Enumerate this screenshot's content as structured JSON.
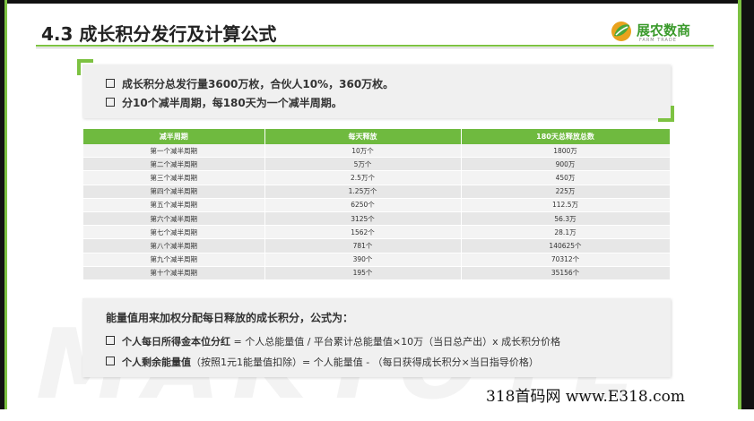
{
  "header": {
    "title": "4.3 成长积分发行及计算公式",
    "logo_text": "展农数商",
    "logo_sub": "FARM TRADE"
  },
  "intro": {
    "lines": [
      "成长积分总发行量3600万枚，合伙人10%，360万枚。",
      "分10个减半周期，每180天为一个减半周期。"
    ]
  },
  "table": {
    "headers": [
      "减半周期",
      "每天释放",
      "180天总释放总数"
    ],
    "rows": [
      [
        "第一个减半周期",
        "10万个",
        "1800万"
      ],
      [
        "第二个减半周期",
        "5万个",
        "900万"
      ],
      [
        "第三个减半周期",
        "2.5万个",
        "450万"
      ],
      [
        "第四个减半周期",
        "1.25万个",
        "225万"
      ],
      [
        "第五个减半周期",
        "6250个",
        "112.5万"
      ],
      [
        "第六个减半周期",
        "3125个",
        "56.3万"
      ],
      [
        "第七个减半周期",
        "1562个",
        "28.1万"
      ],
      [
        "第八个减半周期",
        "781个",
        "140625个"
      ],
      [
        "第九个减半周期",
        "390个",
        "70312个"
      ],
      [
        "第十个减半周期",
        "195个",
        "35156个"
      ]
    ]
  },
  "formula": {
    "heading": "能量值用来加权分配每日释放的成长积分，公式为：",
    "items": [
      {
        "label": "个人每日所得金本位分红",
        "text": " = 个人总能量值 / 平台累计总能量值×10万（当日总产出）x 成长积分价格"
      },
      {
        "label": "个人剩余能量值",
        "text": "（按照1元1能量值扣除）= 个人能量值 - （每日获得成长积分×当日指导价格）"
      }
    ]
  },
  "watermark_bg": "MAKTOTE",
  "footer": {
    "watermark": "318首码网 www.E318.com"
  },
  "colors": {
    "accent_green": "#7dc242",
    "table_header": "#6fba3f",
    "frame": "#111111"
  }
}
